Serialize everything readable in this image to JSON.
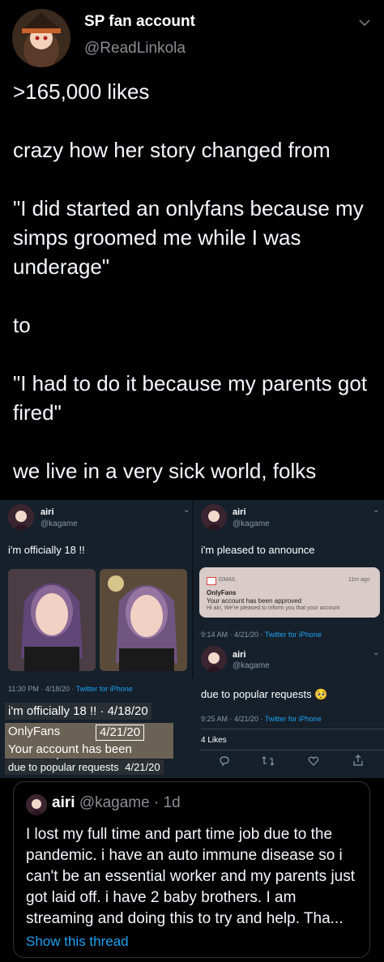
{
  "tweet": {
    "author_name": "SP fan account",
    "author_handle": "@ReadLinkola",
    "text": ">165,000 likes\n\ncrazy how her story changed from\n\n\"I did started an onlyfans because my simps groomed me while I was underage\"\n\nto\n\n\"I had to do it because my parents got fired\"\n\nwe live in a very sick world, folks"
  },
  "embedded": {
    "left_tweet": {
      "name": "airi",
      "handle": "@kagame",
      "text": "i'm officially 18 !!",
      "time": "11:30 PM · 4/18/20 · ",
      "source": "Twitter for iPhone"
    },
    "right_tweet_1": {
      "name": "airi",
      "handle": "@kagame",
      "text": "i'm pleased to announce",
      "notif_app": "GMAIL",
      "notif_time": "11m ago",
      "notif_sender": "OnlyFans",
      "notif_subject": "Your account has been approved",
      "notif_body": "Hi airi, We're pleased to inform you that your account",
      "time": "9:14 AM · 4/21/20 · ",
      "source": "Twitter for iPhone"
    },
    "right_tweet_2": {
      "name": "airi",
      "handle": "@kagame",
      "text": "due to popular requests 🥺",
      "time": "9:25 AM · 4/21/20 · ",
      "source": "Twitter for iPhone",
      "likes": "4 Likes"
    },
    "captions": {
      "c1": "i'm officially 18 !! · 4/18/20",
      "c2_left": "OnlyFans",
      "c2_right": "4/21/20",
      "c3": "Your account has been approved",
      "c4_left": "due to popular requests",
      "c4_right": "4/21/20"
    }
  },
  "quote": {
    "name": "airi",
    "handle_time": "@kagame · 1d",
    "text": "I lost my full time and part time job due to the pandemic. i have an auto immune disease so i can't be an essential worker and my parents just got laid off. i have 2 baby brothers. I am streaming and doing this to try and help. Tha...",
    "show_thread": "Show this thread"
  },
  "colors": {
    "background": "#000000",
    "embed_bg": "#15202b",
    "link": "#1da1f2",
    "muted": "#8a8d91"
  }
}
